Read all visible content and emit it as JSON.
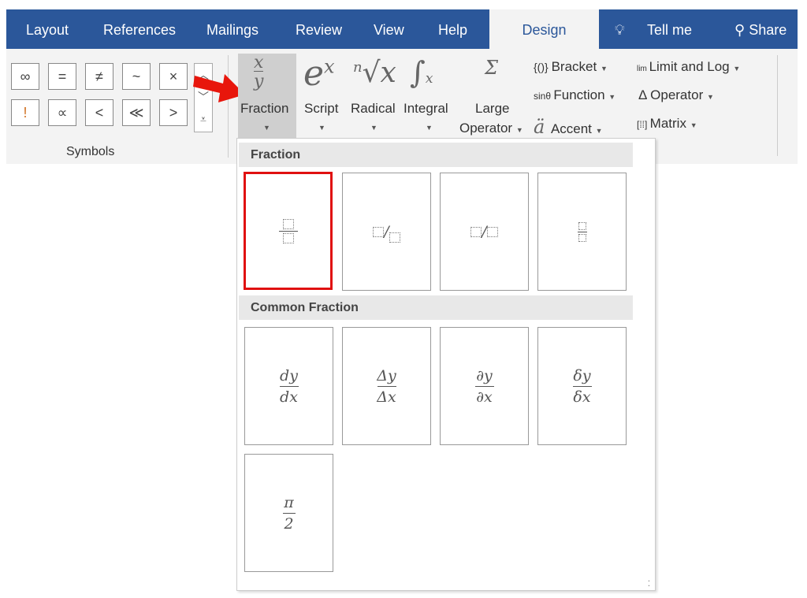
{
  "tabs": [
    "Layout",
    "References",
    "Mailings",
    "Review",
    "View",
    "Help",
    "Design"
  ],
  "tell_me": "Tell me",
  "share": "Share",
  "symbols": {
    "row1": [
      "∞",
      "=",
      "≠",
      "~",
      "×"
    ],
    "row2": [
      "!",
      "∝",
      "<",
      "≪",
      ">"
    ],
    "group_label": "Symbols"
  },
  "structures": {
    "fraction": "Fraction",
    "script": "Script",
    "radical": "Radical",
    "integral": "Integral",
    "large_operator_1": "Large",
    "large_operator_2": "Operator",
    "bracket": "Bracket",
    "function": "Function",
    "accent": "Accent",
    "limit_log": "Limit and Log",
    "operator": "Operator",
    "matrix": "Matrix"
  },
  "dropdown": {
    "section1": "Fraction",
    "section2": "Common Fraction",
    "common": [
      {
        "num": "dy",
        "den": "dx"
      },
      {
        "num": "Δy",
        "den": "Δx"
      },
      {
        "num": "∂y",
        "den": "∂x"
      },
      {
        "num": "δy",
        "den": "δx"
      },
      {
        "num": "π",
        "den": "2"
      }
    ]
  },
  "colors": {
    "accent": "#2b579a",
    "highlight": "#e01010"
  }
}
